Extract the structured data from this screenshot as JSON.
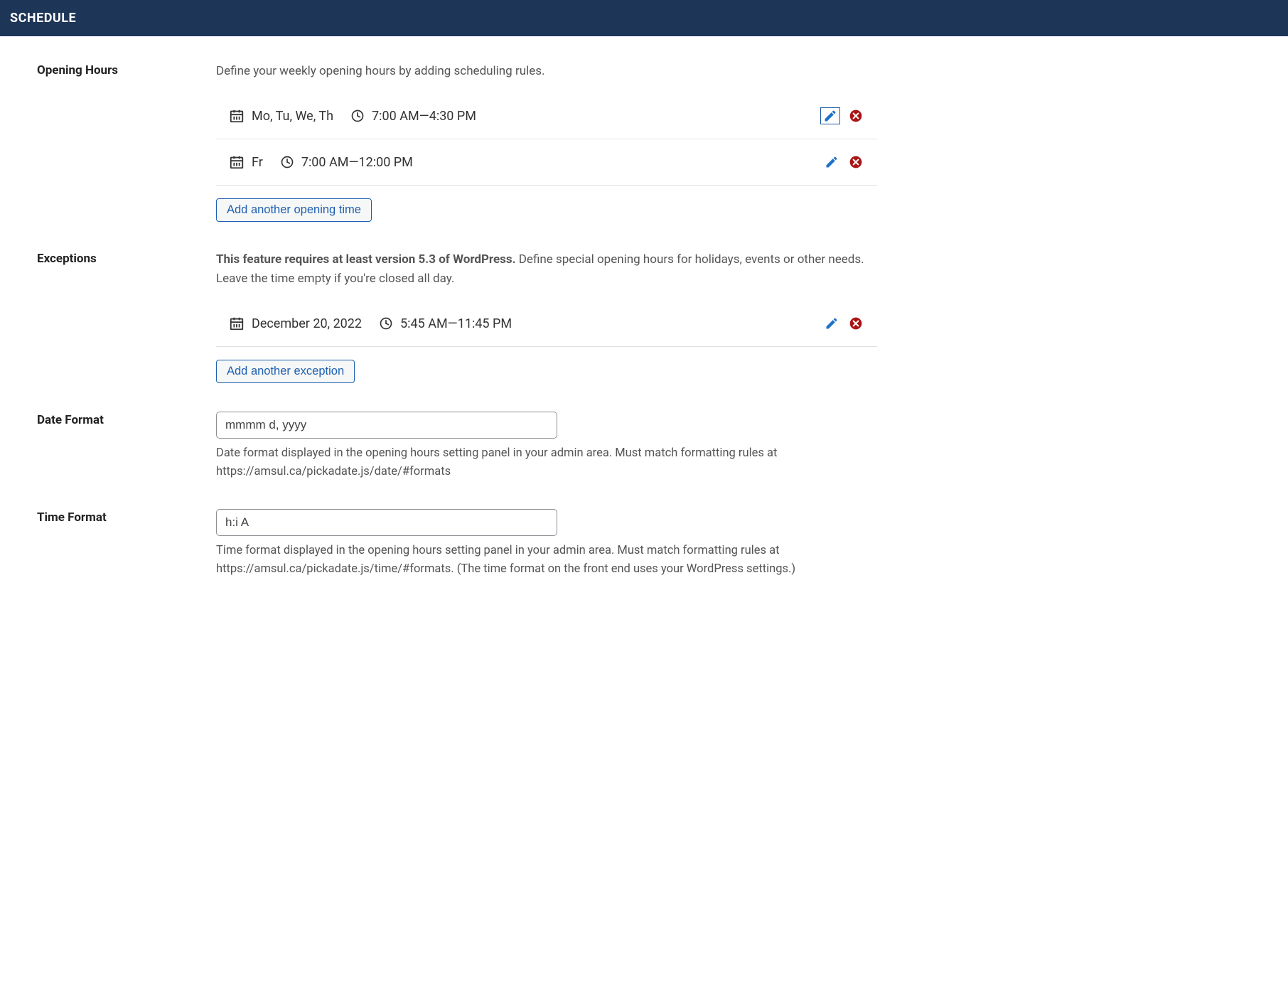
{
  "header": {
    "title": "SCHEDULE"
  },
  "opening": {
    "label": "Opening Hours",
    "description": "Define your weekly opening hours by adding scheduling rules.",
    "rules": [
      {
        "days": "Mo, Tu, We, Th",
        "time": "7:00 AM—4:30 PM"
      },
      {
        "days": "Fr",
        "time": "7:00 AM—12:00 PM"
      }
    ],
    "add_label": "Add another opening time"
  },
  "exceptions": {
    "label": "Exceptions",
    "note_bold": "This feature requires at least version 5.3 of WordPress.",
    "note_rest": " Define special opening hours for holidays, events or other needs. Leave the time empty if you're closed all day.",
    "rules": [
      {
        "date": "December 20, 2022",
        "time": "5:45 AM—11:45 PM"
      }
    ],
    "add_label": "Add another exception"
  },
  "date_format": {
    "label": "Date Format",
    "value": "mmmm d, yyyy",
    "help": "Date format displayed in the opening hours setting panel in your admin area. Must match formatting rules at https://amsul.ca/pickadate.js/date/#formats"
  },
  "time_format": {
    "label": "Time Format",
    "value": "h:i A",
    "help": "Time format displayed in the opening hours setting panel in your admin area. Must match formatting rules at https://amsul.ca/pickadate.js/time/#formats. (The time format on the front end uses your WordPress settings.)"
  }
}
